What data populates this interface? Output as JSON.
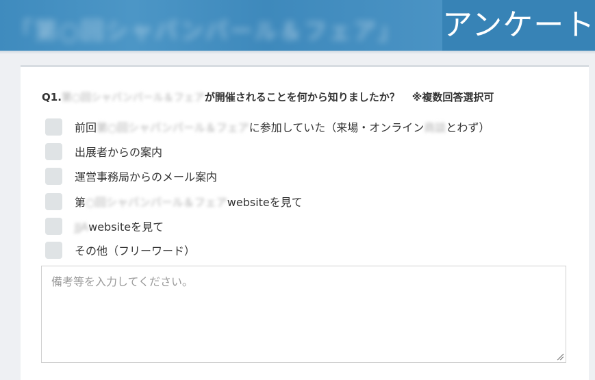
{
  "header": {
    "blurred_title": "「第○回シャパンパール＆フェア」",
    "title": "アンケート"
  },
  "question": {
    "prefix": "Q1.",
    "blurred_event": "第○回シャパンパール＆フェア",
    "text": "が開催されることを何から知りましたか？",
    "note": "※複数回答選択可"
  },
  "options": [
    {
      "before": "前回",
      "blurred": "第○回シャパンパール＆フェア",
      "after": "に参加していた（来場・オンライン",
      "blurred2": "商談",
      "after2": "とわず）"
    },
    {
      "before": "出展者からの案内",
      "blurred": "",
      "after": "",
      "blurred2": "",
      "after2": ""
    },
    {
      "before": "運営事務局からのメール案内",
      "blurred": "",
      "after": "",
      "blurred2": "",
      "after2": ""
    },
    {
      "before": "第",
      "blurred": "○回シャパンパール＆フェア",
      "after": "websiteを見て",
      "blurred2": "",
      "after2": ""
    },
    {
      "before": "",
      "blurred": "JJA",
      "after": "websiteを見て",
      "blurred2": "",
      "after2": ""
    },
    {
      "before": "その他（フリーワード）",
      "blurred": "",
      "after": "",
      "blurred2": "",
      "after2": ""
    }
  ],
  "remarks": {
    "placeholder": "備考等を入力してください。",
    "value": ""
  }
}
